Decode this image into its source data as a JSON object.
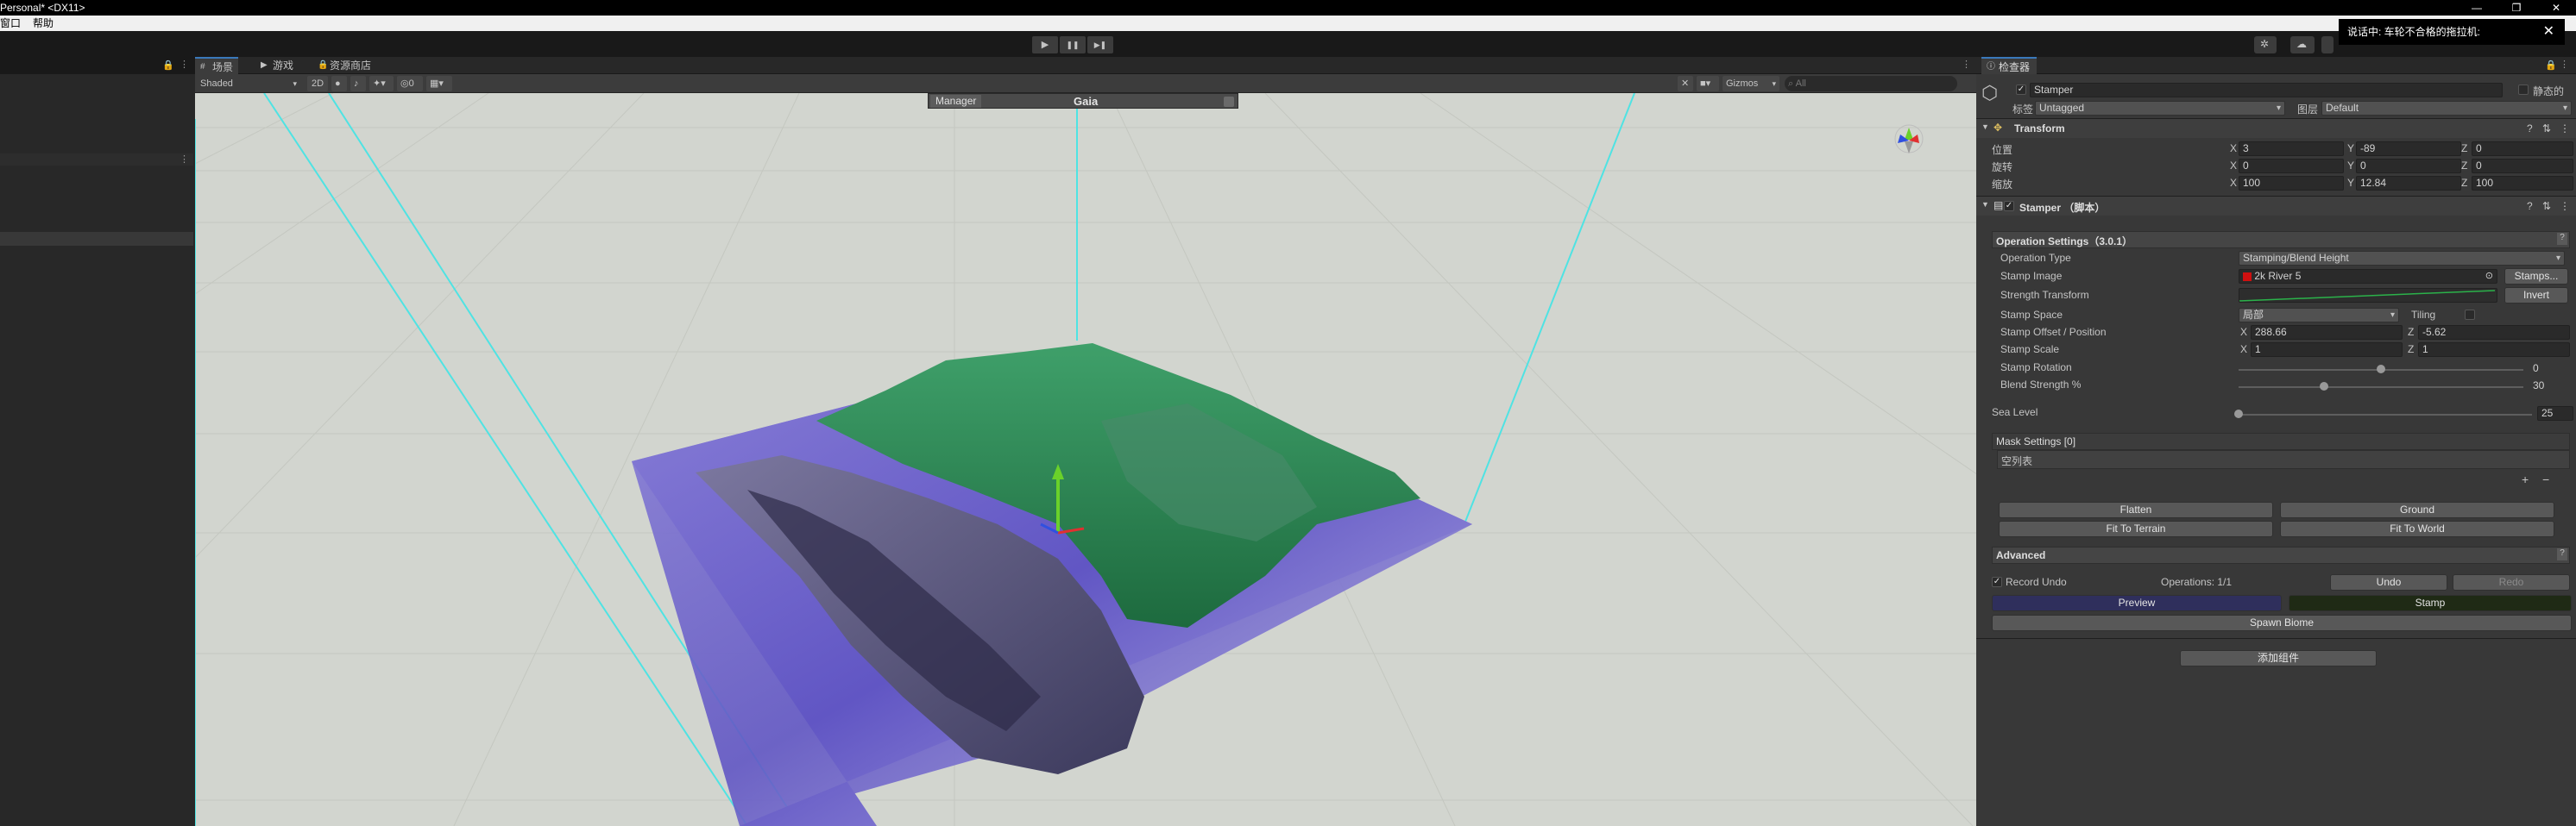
{
  "window": {
    "title": "Personal* <DX11>",
    "controls": [
      "—",
      "❐",
      "✕"
    ]
  },
  "menu": {
    "items": [
      "窗口",
      "帮助"
    ]
  },
  "notification": {
    "text": "说话中: 车轮不合格的拖拉机:",
    "close": "✕"
  },
  "toolbar": {
    "play": "▶",
    "pause": "❚❚",
    "step": "▶❚"
  },
  "scene": {
    "tabs": [
      {
        "icon": "#",
        "label": "场景"
      },
      {
        "icon": "▶",
        "label": "游戏"
      },
      {
        "icon": "🔒",
        "label": "资源商店"
      }
    ],
    "shading_mode": "Shaded",
    "mode_2d": "2D",
    "hidden_count": "0",
    "gizmos_label": "Gizmos",
    "search_placeholder": "All"
  },
  "gaia_manager": {
    "tab": "Manager",
    "title": "Gaia"
  },
  "inspector": {
    "tab_label": "检查器",
    "object": {
      "name": "Stamper",
      "static_label": "静态的",
      "tag_label": "标签",
      "tag_value": "Untagged",
      "layer_label": "图层",
      "layer_value": "Default"
    },
    "transform": {
      "title": "Transform",
      "rows": [
        {
          "label": "位置",
          "x": "3",
          "y": "-89",
          "z": "0"
        },
        {
          "label": "旋转",
          "x": "0",
          "y": "0",
          "z": "0"
        },
        {
          "label": "缩放",
          "x": "100",
          "y": "12.84",
          "z": "100"
        }
      ],
      "axis_x": "X",
      "axis_y": "Y",
      "axis_z": "Z"
    },
    "stamper": {
      "title": "Stamper （脚本）",
      "operation_section": "Operation Settings（3.0.1）",
      "operation_type_label": "Operation Type",
      "operation_type_value": "Stamping/Blend Height",
      "stamp_image_label": "Stamp Image",
      "stamp_image_value": "2k River 5",
      "stamps_button": "Stamps...",
      "strength_transform_label": "Strength Transform",
      "invert_button": "Invert",
      "stamp_space_label": "Stamp Space",
      "stamp_space_value": "局部",
      "tiling_label": "Tiling",
      "offset_label": "Stamp Offset / Position",
      "offset_x": "288.66",
      "offset_z": "-5.62",
      "scale_label": "Stamp Scale",
      "scale_x": "1",
      "scale_z": "1",
      "rotation_label": "Stamp Rotation",
      "rotation_value": "0",
      "rotation_fraction": 0.5,
      "blend_label": "Blend Strength %",
      "blend_value": "30",
      "blend_fraction": 0.3,
      "sea_level_label": "Sea Level",
      "sea_level_value": "25",
      "sea_level_fraction": 0.0,
      "mask_settings": "Mask Settings [0]",
      "mask_empty": "空列表",
      "add": "+",
      "remove": "−",
      "flatten": "Flatten",
      "ground": "Ground",
      "fit_terrain": "Fit To Terrain",
      "fit_world": "Fit To World",
      "advanced": "Advanced",
      "record_undo": "Record Undo",
      "operations": "Operations: 1/1",
      "undo": "Undo",
      "redo": "Redo",
      "preview": "Preview",
      "stamp": "Stamp",
      "spawn_biome": "Spawn Biome"
    },
    "add_component": "添加组件"
  },
  "colors": {
    "accent_tab": "#3a79bb",
    "preview_button": "#2f2f5c",
    "stamp_button": "#1f2a15",
    "scene_ground": "#d3d6d0"
  }
}
